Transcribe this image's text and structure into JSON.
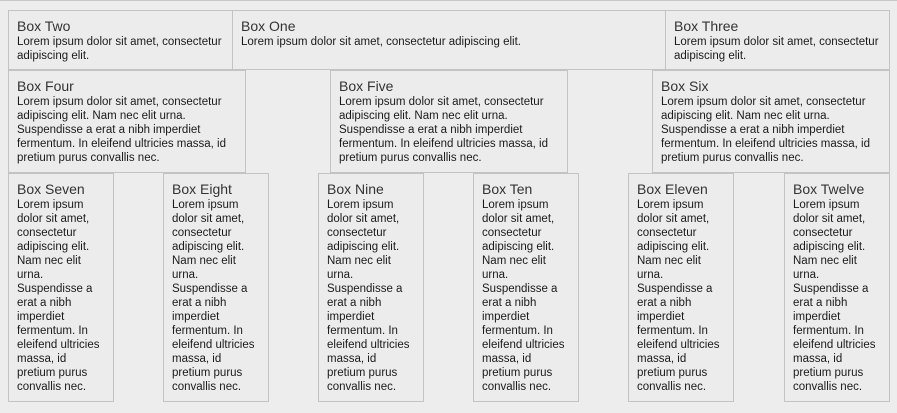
{
  "boxes": [
    {
      "title": "Box One",
      "text": "Lorem ipsum dolor sit amet, consectetur adipiscing elit."
    },
    {
      "title": "Box Two",
      "text": "Lorem ipsum dolor sit amet, consectetur adipiscing elit."
    },
    {
      "title": "Box Three",
      "text": "Lorem ipsum dolor sit amet, consectetur adipiscing elit."
    },
    {
      "title": "Box Four",
      "text": "Lorem ipsum dolor sit amet, consectetur adipiscing elit. Nam nec elit urna. Suspendisse a erat a nibh imperdiet fermentum. In eleifend ultricies massa, id pretium purus convallis nec."
    },
    {
      "title": "Box Five",
      "text": "Lorem ipsum dolor sit amet, consectetur adipiscing elit. Nam nec elit urna. Suspendisse a erat a nibh imperdiet fermentum. In eleifend ultricies massa, id pretium purus convallis nec."
    },
    {
      "title": "Box Six",
      "text": "Lorem ipsum dolor sit amet, consectetur adipiscing elit. Nam nec elit urna. Suspendisse a erat a nibh imperdiet fermentum. In eleifend ultricies massa, id pretium purus convallis nec."
    },
    {
      "title": "Box Seven",
      "text": "Lorem ipsum dolor sit amet, consectetur adipiscing elit. Nam nec elit urna. Suspendisse a erat a nibh imperdiet fermentum. In eleifend ultricies massa, id pretium purus convallis nec."
    },
    {
      "title": "Box Eight",
      "text": "Lorem ipsum dolor sit amet, consectetur adipiscing elit. Nam nec elit urna. Suspendisse a erat a nibh imperdiet fermentum. In eleifend ultricies massa, id pretium purus convallis nec."
    },
    {
      "title": "Box Nine",
      "text": "Lorem ipsum dolor sit amet, consectetur adipiscing elit. Nam nec elit urna. Suspendisse a erat a nibh imperdiet fermentum. In eleifend ultricies massa, id pretium purus convallis nec."
    },
    {
      "title": "Box Ten",
      "text": "Lorem ipsum dolor sit amet, consectetur adipiscing elit. Nam nec elit urna. Suspendisse a erat a nibh imperdiet fermentum. In eleifend ultricies massa, id pretium purus convallis nec."
    },
    {
      "title": "Box Eleven",
      "text": "Lorem ipsum dolor sit amet, consectetur adipiscing elit. Nam nec elit urna. Suspendisse a erat a nibh imperdiet fermentum. In eleifend ultricies massa, id pretium purus convallis nec."
    },
    {
      "title": "Box Twelve",
      "text": "Lorem ipsum dolor sit amet, consectetur adipiscing elit. Nam nec elit urna. Suspendisse a erat a nibh imperdiet fermentum. In eleifend ultricies massa, id pretium purus convallis nec."
    }
  ]
}
